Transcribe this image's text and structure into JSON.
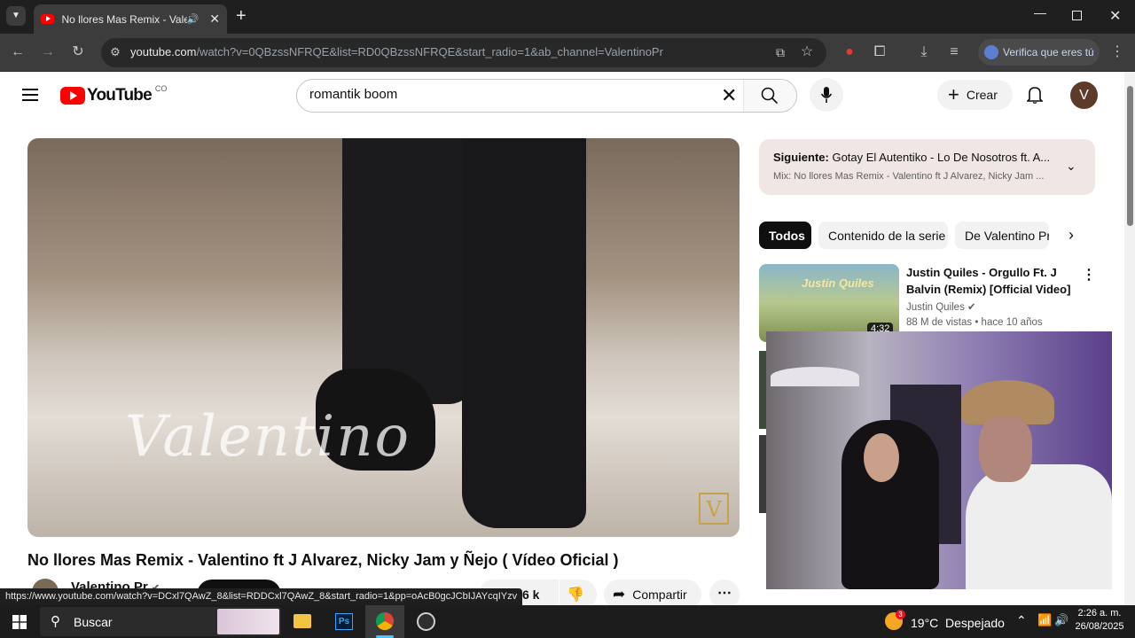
{
  "browser": {
    "tab_title": "No llores Mas Remix - Valen",
    "url_host": "youtube.com",
    "url_path": "/watch?v=0QBzssNFRQE&list=RD0QBzssNFRQE&start_radio=1&ab_channel=ValentinoPr",
    "verify_label": "Verifica que eres tú",
    "status_url": "https://www.youtube.com/watch?v=DCxl7QAwZ_8&list=RDDCxl7QAwZ_8&start_radio=1&pp=oAcB0gcJCbIJAYcqIYzv"
  },
  "header": {
    "logo_text": "YouTube",
    "country": "CO",
    "search_value": "romantik boom",
    "create_label": "Crear",
    "avatar_letter": "V"
  },
  "video": {
    "watermark": "Valentino",
    "title": "No llores Mas Remix - Valentino ft J Alvarez, Nicky Jam y Ñejo ( Vídeo Oficial )",
    "channel": "Valentino Pr",
    "likes": "6 k",
    "share_label": "Compartir"
  },
  "up_next": {
    "label": "Siguiente:",
    "title": "Gotay El Autentiko - Lo De Nosotros ft. A...",
    "mix": "Mix: No llores Mas Remix - Valentino ft J Alvarez, Nicky Jam ..."
  },
  "chips": [
    "Todos",
    "Contenido de la serie",
    "De Valentino Pr"
  ],
  "recommendations": [
    {
      "title_line1": "Justin Quiles - Orgullo Ft. J",
      "title_line2": "Balvin (Remix) [Official Video]",
      "channel": "Justin Quiles",
      "meta": "88 M de vistas • hace 10 años",
      "duration": "4:32",
      "thumb_text": "Justin Quiles"
    }
  ],
  "taskbar": {
    "search_label": "Buscar",
    "weather_temp": "19°C",
    "weather_desc": "Despejado",
    "weather_badge": "3",
    "time": "2:26 a. m.",
    "date": "26/08/2025"
  },
  "colors": {
    "yt_red": "#ff0000",
    "chrome_dark": "#3c3c3c",
    "taskbar": "#1c1c1c"
  }
}
